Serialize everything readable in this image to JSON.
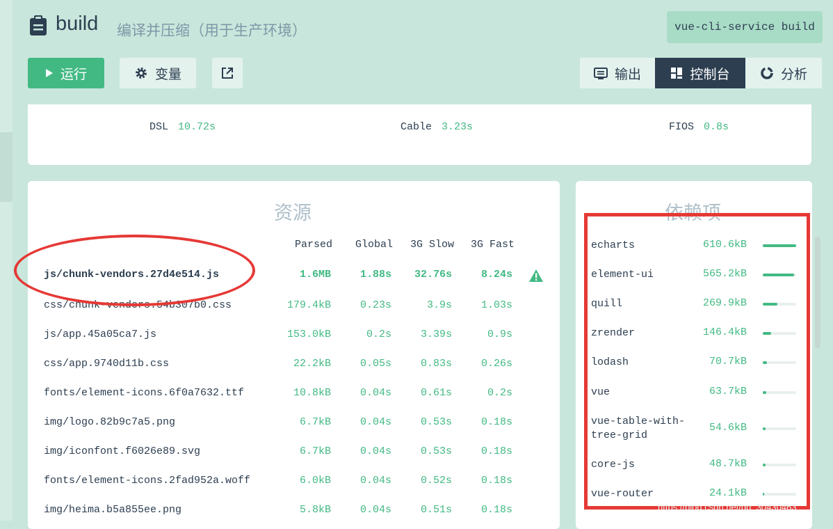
{
  "header": {
    "title": "build",
    "subtitle": "编译并压缩（用于生产环境）",
    "command": "vue-cli-service build",
    "title_icon": "clipboard-icon"
  },
  "toolbar": {
    "run_label": "运行",
    "vars_label": "变量",
    "run_icon": "play-icon",
    "vars_icon": "gear-icon",
    "open_icon": "external-link-icon",
    "tabs": [
      {
        "label": "输出",
        "icon": "terminal-icon",
        "active": false
      },
      {
        "label": "控制台",
        "icon": "dashboard-icon",
        "active": true
      },
      {
        "label": "分析",
        "icon": "donut-icon",
        "active": false
      }
    ]
  },
  "speed": [
    {
      "label": "DSL",
      "value": "10.72s"
    },
    {
      "label": "Cable",
      "value": "3.23s"
    },
    {
      "label": "FIOS",
      "value": "0.8s"
    }
  ],
  "assets": {
    "title": "资源",
    "columns": [
      "Parsed",
      "Global",
      "3G Slow",
      "3G Fast"
    ],
    "rows": [
      {
        "name": "js/chunk-vendors.27d4e514.js",
        "parsed": "1.6MB",
        "global": "1.88s",
        "slow": "32.76s",
        "fast": "8.24s",
        "warning": true
      },
      {
        "name": "css/chunk-vendors.54b307b0.css",
        "parsed": "179.4kB",
        "global": "0.23s",
        "slow": "3.9s",
        "fast": "1.03s"
      },
      {
        "name": "js/app.45a05ca7.js",
        "parsed": "153.0kB",
        "global": "0.2s",
        "slow": "3.39s",
        "fast": "0.9s"
      },
      {
        "name": "css/app.9740d11b.css",
        "parsed": "22.2kB",
        "global": "0.05s",
        "slow": "0.83s",
        "fast": "0.26s"
      },
      {
        "name": "fonts/element-icons.6f0a7632.ttf",
        "parsed": "10.8kB",
        "global": "0.04s",
        "slow": "0.61s",
        "fast": "0.2s"
      },
      {
        "name": "img/logo.82b9c7a5.png",
        "parsed": "6.7kB",
        "global": "0.04s",
        "slow": "0.53s",
        "fast": "0.18s"
      },
      {
        "name": "img/iconfont.f6026e89.svg",
        "parsed": "6.7kB",
        "global": "0.04s",
        "slow": "0.53s",
        "fast": "0.18s"
      },
      {
        "name": "fonts/element-icons.2fad952a.woff",
        "parsed": "6.0kB",
        "global": "0.04s",
        "slow": "0.52s",
        "fast": "0.18s"
      },
      {
        "name": "img/heima.b5a855ee.png",
        "parsed": "5.8kB",
        "global": "0.04s",
        "slow": "0.51s",
        "fast": "0.18s"
      }
    ]
  },
  "deps": {
    "title": "依赖项",
    "items": [
      {
        "name": "echarts",
        "size": "610.6kB",
        "ratio": 1.0
      },
      {
        "name": "element-ui",
        "size": "565.2kB",
        "ratio": 0.93
      },
      {
        "name": "quill",
        "size": "269.9kB",
        "ratio": 0.44
      },
      {
        "name": "zrender",
        "size": "146.4kB",
        "ratio": 0.24
      },
      {
        "name": "lodash",
        "size": "70.7kB",
        "ratio": 0.12
      },
      {
        "name": "vue",
        "size": "63.7kB",
        "ratio": 0.1
      },
      {
        "name": "vue-table-with-tree-grid",
        "size": "54.6kB",
        "ratio": 0.09
      },
      {
        "name": "core-js",
        "size": "48.7kB",
        "ratio": 0.08
      },
      {
        "name": "vue-router",
        "size": "24.1kB",
        "ratio": 0.04
      }
    ]
  },
  "watermark": "https://blog.csdn.net/qq_30430463",
  "colors": {
    "accent": "#42b983",
    "dark": "#2c3e50",
    "annotation": "#e53935"
  }
}
